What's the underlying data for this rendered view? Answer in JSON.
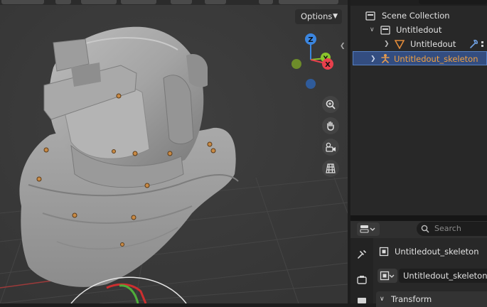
{
  "viewport": {
    "options_label": "Options",
    "gizmo": {
      "z": "Z",
      "y": "Y",
      "x": "X"
    },
    "nav_buttons": [
      "zoom-icon",
      "hand-pan-icon",
      "camera-icon",
      "grid-icon"
    ]
  },
  "outliner": {
    "items": [
      {
        "label": "Scene Collection",
        "icon": "scene-collection-icon"
      },
      {
        "label": "Untitledout",
        "icon": "collection-icon"
      },
      {
        "label": "Untitledout",
        "icon": "mesh-icon"
      },
      {
        "label": "Untitledout_skeleton",
        "icon": "armature-icon",
        "selected": true
      }
    ]
  },
  "properties": {
    "search_placeholder": "Search",
    "object_name": "Untitledout_skeleton",
    "data_name": "Untitledout_skeleton",
    "section_title": "Transform"
  },
  "colors": {
    "selected_row": "#334d80",
    "selected_text": "#f0a040",
    "axis_x": "#e8404c",
    "axis_y": "#8ac42c",
    "axis_z": "#3b86e0"
  }
}
